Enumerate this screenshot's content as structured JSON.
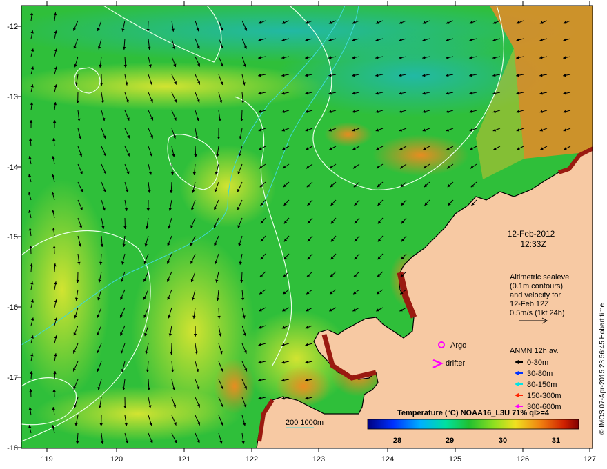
{
  "map": {
    "lon_ticks": [
      "119",
      "120",
      "121",
      "122",
      "123",
      "124",
      "125",
      "126",
      "127"
    ],
    "lat_ticks": [
      "-12",
      "-13",
      "-14",
      "-15",
      "-16",
      "-17",
      "-18"
    ],
    "date": "12-Feb-2012",
    "time": "12:33Z",
    "altimetry_lines": [
      "Altimetric sealevel",
      "(0.1m contours)",
      "and velocity for",
      "12-Feb 12Z",
      "0.5m/s (1kt 24h)"
    ],
    "argo_label": "Argo",
    "drifter_label": "drifter",
    "anmn_title": "ANMN 12h av.",
    "anmn_depths": [
      {
        "label": "0-30m",
        "color": "#000000"
      },
      {
        "label": "30-80m",
        "color": "#0033ff"
      },
      {
        "label": "80-150m",
        "color": "#00e5e5"
      },
      {
        "label": "150-300m",
        "color": "#ff2200"
      },
      {
        "label": "300-600m",
        "color": "#ff00ff"
      }
    ],
    "isobath_label": "200  1000m",
    "colorbar_title": "Temperature (°C) NOAA16_L3U 71% ql>=4",
    "colorbar_ticks": [
      "28",
      "29",
      "30",
      "31"
    ],
    "credit": "© IMOS 07-Apr-2015 23:56:45 Hobart time",
    "colors": {
      "land": "#f7c9a3",
      "sst_green": "#2fc23a",
      "sst_yellow": "#d9e02a",
      "sst_orange": "#f08020",
      "contour": "#e8ffe8",
      "isobath": "#3fd4d4",
      "argo": "#ff00ff"
    }
  }
}
